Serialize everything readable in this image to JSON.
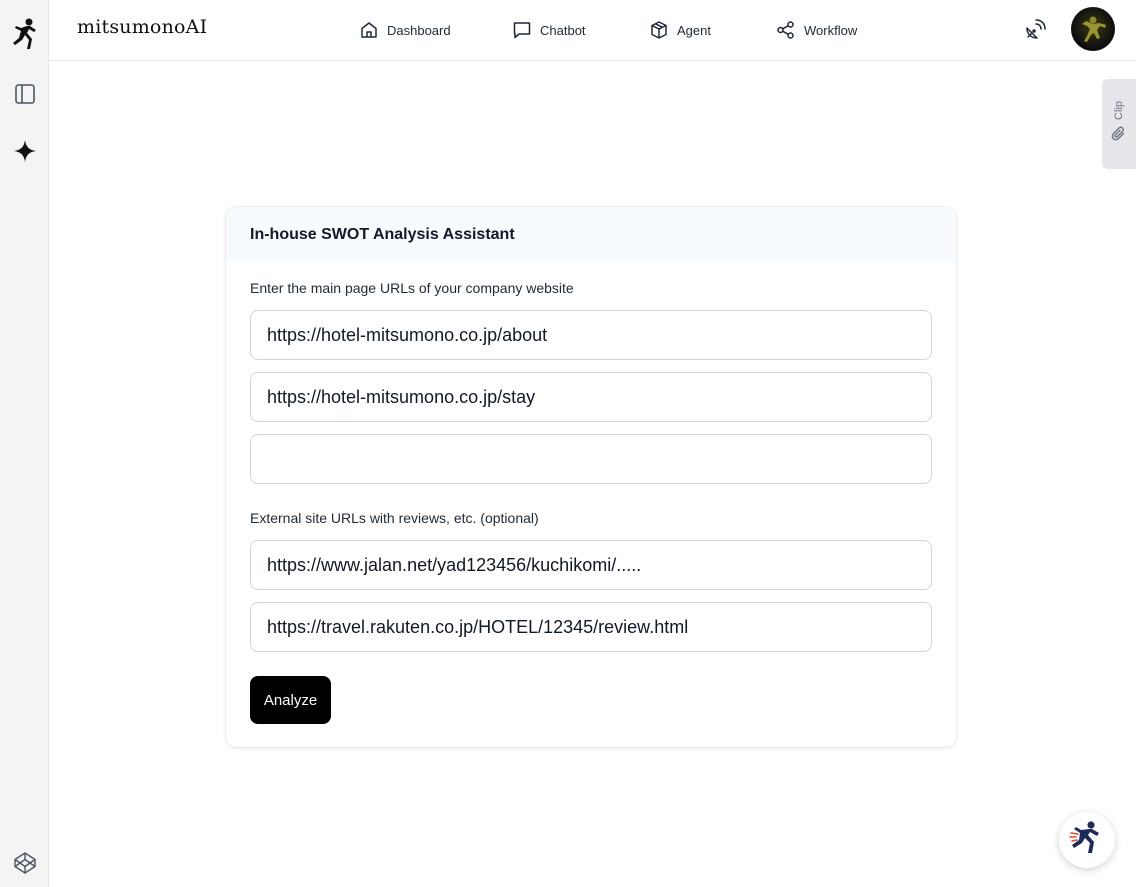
{
  "app": {
    "brand": "mitsumonoAI"
  },
  "nav": {
    "items": [
      {
        "label": "Dashboard",
        "icon": "home-icon"
      },
      {
        "label": "Chatbot",
        "icon": "chat-bubble-icon"
      },
      {
        "label": "Agent",
        "icon": "cube-icon"
      },
      {
        "label": "Workflow",
        "icon": "share-nodes-icon"
      }
    ]
  },
  "sidebar": {
    "icons": [
      "runner-logo-icon",
      "panel-toggle-icon",
      "sparkle-icon",
      "codepen-icon"
    ]
  },
  "clip": {
    "label": "Clip",
    "icon": "paperclip-icon"
  },
  "form": {
    "title": "In-house SWOT Analysis Assistant",
    "company_label": "Enter the main page URLs of your company website",
    "company_urls": [
      "https://hotel-mitsumono.co.jp/about",
      "https://hotel-mitsumono.co.jp/stay",
      ""
    ],
    "external_label": "External site URLs with reviews, etc. (optional)",
    "external_urls": [
      "https://www.jalan.net/yad123456/kuchikomi/.....",
      "https://travel.rakuten.co.jp/HOTEL/12345/review.html"
    ],
    "submit_label": "Analyze"
  },
  "colors": {
    "accent": "#000000",
    "sidebar_bg": "#f4f4f5",
    "header_bg": "#f7fbff",
    "runner_navy": "#1e2a5a"
  }
}
